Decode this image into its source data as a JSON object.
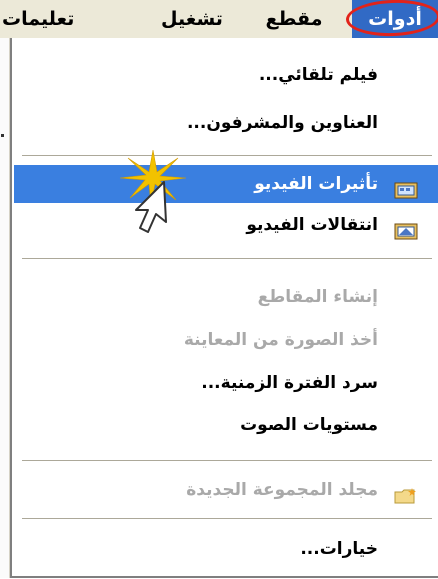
{
  "menubar": {
    "tools": "أدوات",
    "clip": "مقطع",
    "play": "تشغيل",
    "help": "تعليمات"
  },
  "menu": {
    "items": [
      {
        "label": "فيلم تلقائي...",
        "state": "enabled"
      },
      {
        "label": "العناوين والمشرفون...",
        "state": "enabled"
      },
      {
        "label": "تأثيرات الفيديو",
        "state": "highlighted",
        "icon": "video-effects-icon"
      },
      {
        "label": "انتقالات الفيديو",
        "state": "enabled",
        "icon": "video-transitions-icon"
      },
      {
        "label": "إنشاء المقاطع",
        "state": "disabled"
      },
      {
        "label": "أخذ الصورة من المعاينة",
        "state": "disabled"
      },
      {
        "label": "سرد الفترة الزمنية...",
        "state": "enabled"
      },
      {
        "label": "مستويات الصوت",
        "state": "enabled"
      },
      {
        "label": "مجلد المجموعة الجديدة",
        "state": "disabled",
        "icon": "new-folder-icon"
      },
      {
        "label": "خيارات...",
        "state": "enabled"
      }
    ]
  },
  "colors": {
    "highlight": "#3a7fe0",
    "menubar_selected": "#316ac5",
    "annotation_circle": "#e2231a",
    "sparkle": "#f2c200",
    "disabled_text": "#a9a9a9"
  }
}
